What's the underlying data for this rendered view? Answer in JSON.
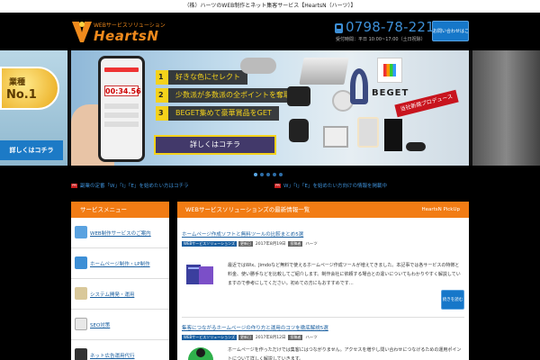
{
  "topbar": {
    "text": "（株）ハーツのWEB制作とネット集客サービス【HeartsN（ハーツ）】"
  },
  "header": {
    "logo_sub": "WEBサービスソリューション",
    "logo_text": "HeartsN",
    "phone": "0798-78-2212",
    "hours": "受付時間：平日 10:00~17:00（土日祝除）",
    "contact_label": "お問い合わせはこちら"
  },
  "hero": {
    "left_badge_top": "業種",
    "left_badge_no": "No.1",
    "left_detail": "詳しくはコチラ",
    "timer": "00:34.56",
    "bullets": [
      {
        "num": "1",
        "text": "好きな色にセレクト"
      },
      {
        "num": "2",
        "text": "少数派が多数派の全ポイントを奪取"
      },
      {
        "num": "3",
        "text": "BEGET集めて豪華賞品をGET"
      }
    ],
    "cta": "詳しくはコチラ",
    "brand": "BEGET",
    "ribbon": "当社新規プロデュース",
    "slide_count": 5,
    "active_slide": 0
  },
  "ticker": [
    {
      "tag": "PR",
      "text": "副業の定番「W」「I」「E」を始めたい方はコチラ"
    },
    {
      "tag": "PR",
      "text": "W」「I」「E」を始めたい方向けの情報を掲載中"
    }
  ],
  "sidebar": {
    "title": "サービスメニュー",
    "items": [
      {
        "label": "WEB制作サービスのご案内",
        "icon": "web-design-icon",
        "color": "#5aa2e0"
      },
      {
        "label": "ホームページ制作・LP制作",
        "icon": "monitor-icon",
        "color": "#3d8fd6"
      },
      {
        "label": "システム開発・運用",
        "icon": "document-icon",
        "color": "#d9c89a"
      },
      {
        "label": "SEO対策",
        "icon": "seo-chart-icon",
        "color": "#e8e8e8"
      },
      {
        "label": "ネット広告運用代行",
        "icon": "gamepad-icon",
        "color": "#333333"
      }
    ]
  },
  "main": {
    "title": "WEBサービスソリューションズの最新情報一覧",
    "pickup": "HeartsN PickUp",
    "articles": [
      {
        "title": "ホームページ作成ソフトと無料ツールの比較まとめ5選",
        "category": "WEBサービスソリューションズ",
        "date_label": "更新日",
        "date": "2017年8月19日",
        "author_label": "投稿者",
        "author": "ハーツ",
        "excerpt": "最近ではWix、Jimdoなど無料で使えるホームページ作成ツールが増えてきました。本記事では各サービスの特徴と料金、使い勝手などを比較してご紹介します。制作会社に依頼する場合との違いについてもわかりやすく解説していますので参考にしてください。初めての方にもおすすめです…",
        "more": "続きを読む"
      },
      {
        "title": "集客につながるホームページの作り方と運用のコツを徹底解説5選",
        "category": "WEBサービスソリューションズ",
        "date_label": "更新日",
        "date": "2017年8月12日",
        "author_label": "投稿者",
        "author": "ハーツ",
        "excerpt": "ホームページを作っただけでは集客にはつながりません。アクセスを増やし問い合わせにつなげるための運用ポイントについて詳しく解説していきます。"
      }
    ]
  },
  "colors": {
    "accent": "#f27c14",
    "link": "#1a5fa0",
    "brand_blue": "#1677c9"
  }
}
